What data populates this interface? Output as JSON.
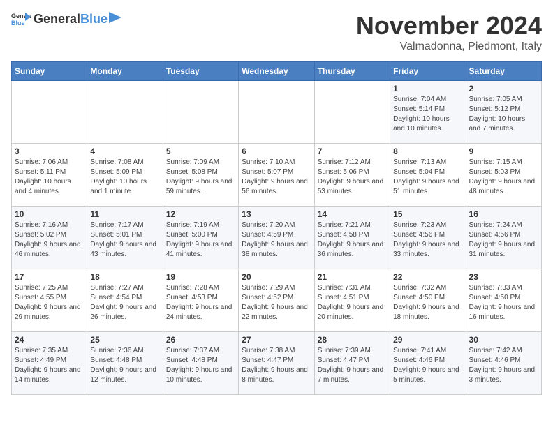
{
  "header": {
    "logo_general": "General",
    "logo_blue": "Blue",
    "month": "November 2024",
    "location": "Valmadonna, Piedmont, Italy"
  },
  "days_of_week": [
    "Sunday",
    "Monday",
    "Tuesday",
    "Wednesday",
    "Thursday",
    "Friday",
    "Saturday"
  ],
  "weeks": [
    [
      {
        "day": "",
        "info": ""
      },
      {
        "day": "",
        "info": ""
      },
      {
        "day": "",
        "info": ""
      },
      {
        "day": "",
        "info": ""
      },
      {
        "day": "",
        "info": ""
      },
      {
        "day": "1",
        "info": "Sunrise: 7:04 AM\nSunset: 5:14 PM\nDaylight: 10 hours and 10 minutes."
      },
      {
        "day": "2",
        "info": "Sunrise: 7:05 AM\nSunset: 5:12 PM\nDaylight: 10 hours and 7 minutes."
      }
    ],
    [
      {
        "day": "3",
        "info": "Sunrise: 7:06 AM\nSunset: 5:11 PM\nDaylight: 10 hours and 4 minutes."
      },
      {
        "day": "4",
        "info": "Sunrise: 7:08 AM\nSunset: 5:09 PM\nDaylight: 10 hours and 1 minute."
      },
      {
        "day": "5",
        "info": "Sunrise: 7:09 AM\nSunset: 5:08 PM\nDaylight: 9 hours and 59 minutes."
      },
      {
        "day": "6",
        "info": "Sunrise: 7:10 AM\nSunset: 5:07 PM\nDaylight: 9 hours and 56 minutes."
      },
      {
        "day": "7",
        "info": "Sunrise: 7:12 AM\nSunset: 5:06 PM\nDaylight: 9 hours and 53 minutes."
      },
      {
        "day": "8",
        "info": "Sunrise: 7:13 AM\nSunset: 5:04 PM\nDaylight: 9 hours and 51 minutes."
      },
      {
        "day": "9",
        "info": "Sunrise: 7:15 AM\nSunset: 5:03 PM\nDaylight: 9 hours and 48 minutes."
      }
    ],
    [
      {
        "day": "10",
        "info": "Sunrise: 7:16 AM\nSunset: 5:02 PM\nDaylight: 9 hours and 46 minutes."
      },
      {
        "day": "11",
        "info": "Sunrise: 7:17 AM\nSunset: 5:01 PM\nDaylight: 9 hours and 43 minutes."
      },
      {
        "day": "12",
        "info": "Sunrise: 7:19 AM\nSunset: 5:00 PM\nDaylight: 9 hours and 41 minutes."
      },
      {
        "day": "13",
        "info": "Sunrise: 7:20 AM\nSunset: 4:59 PM\nDaylight: 9 hours and 38 minutes."
      },
      {
        "day": "14",
        "info": "Sunrise: 7:21 AM\nSunset: 4:58 PM\nDaylight: 9 hours and 36 minutes."
      },
      {
        "day": "15",
        "info": "Sunrise: 7:23 AM\nSunset: 4:56 PM\nDaylight: 9 hours and 33 minutes."
      },
      {
        "day": "16",
        "info": "Sunrise: 7:24 AM\nSunset: 4:56 PM\nDaylight: 9 hours and 31 minutes."
      }
    ],
    [
      {
        "day": "17",
        "info": "Sunrise: 7:25 AM\nSunset: 4:55 PM\nDaylight: 9 hours and 29 minutes."
      },
      {
        "day": "18",
        "info": "Sunrise: 7:27 AM\nSunset: 4:54 PM\nDaylight: 9 hours and 26 minutes."
      },
      {
        "day": "19",
        "info": "Sunrise: 7:28 AM\nSunset: 4:53 PM\nDaylight: 9 hours and 24 minutes."
      },
      {
        "day": "20",
        "info": "Sunrise: 7:29 AM\nSunset: 4:52 PM\nDaylight: 9 hours and 22 minutes."
      },
      {
        "day": "21",
        "info": "Sunrise: 7:31 AM\nSunset: 4:51 PM\nDaylight: 9 hours and 20 minutes."
      },
      {
        "day": "22",
        "info": "Sunrise: 7:32 AM\nSunset: 4:50 PM\nDaylight: 9 hours and 18 minutes."
      },
      {
        "day": "23",
        "info": "Sunrise: 7:33 AM\nSunset: 4:50 PM\nDaylight: 9 hours and 16 minutes."
      }
    ],
    [
      {
        "day": "24",
        "info": "Sunrise: 7:35 AM\nSunset: 4:49 PM\nDaylight: 9 hours and 14 minutes."
      },
      {
        "day": "25",
        "info": "Sunrise: 7:36 AM\nSunset: 4:48 PM\nDaylight: 9 hours and 12 minutes."
      },
      {
        "day": "26",
        "info": "Sunrise: 7:37 AM\nSunset: 4:48 PM\nDaylight: 9 hours and 10 minutes."
      },
      {
        "day": "27",
        "info": "Sunrise: 7:38 AM\nSunset: 4:47 PM\nDaylight: 9 hours and 8 minutes."
      },
      {
        "day": "28",
        "info": "Sunrise: 7:39 AM\nSunset: 4:47 PM\nDaylight: 9 hours and 7 minutes."
      },
      {
        "day": "29",
        "info": "Sunrise: 7:41 AM\nSunset: 4:46 PM\nDaylight: 9 hours and 5 minutes."
      },
      {
        "day": "30",
        "info": "Sunrise: 7:42 AM\nSunset: 4:46 PM\nDaylight: 9 hours and 3 minutes."
      }
    ]
  ]
}
